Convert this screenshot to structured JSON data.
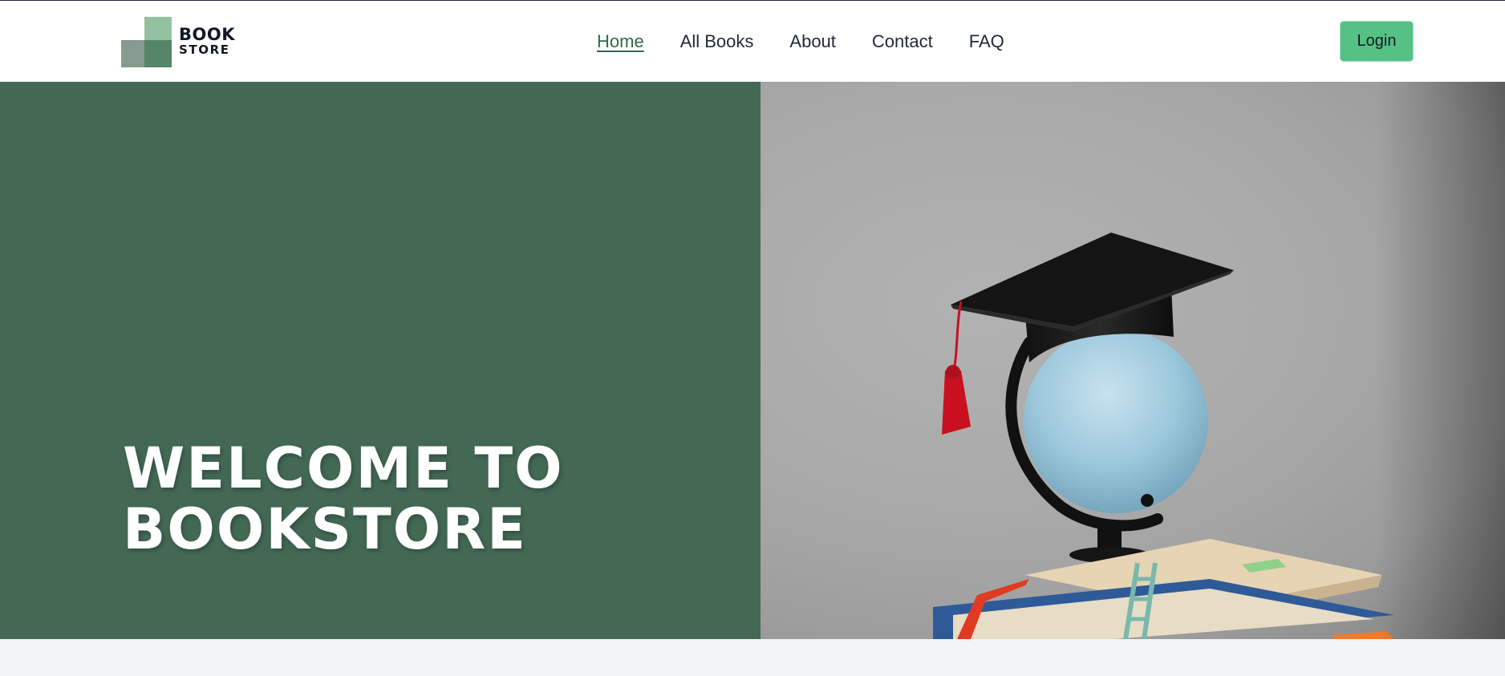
{
  "brand": {
    "line1": "BOOK",
    "line2": "STORE"
  },
  "nav": {
    "items": [
      {
        "label": "Home",
        "active": true
      },
      {
        "label": "All Books",
        "active": false
      },
      {
        "label": "About",
        "active": false
      },
      {
        "label": "Contact",
        "active": false
      },
      {
        "label": "FAQ",
        "active": false
      }
    ]
  },
  "header": {
    "login_label": "Login"
  },
  "hero": {
    "title_line1": "WELCOME TO",
    "title_line2": "BOOKSTORE",
    "image_subject": "graduation-cap-on-globe-with-books"
  },
  "colors": {
    "hero_green": "#436955",
    "accent_green": "#55c184",
    "active_link": "#2f6a44"
  }
}
